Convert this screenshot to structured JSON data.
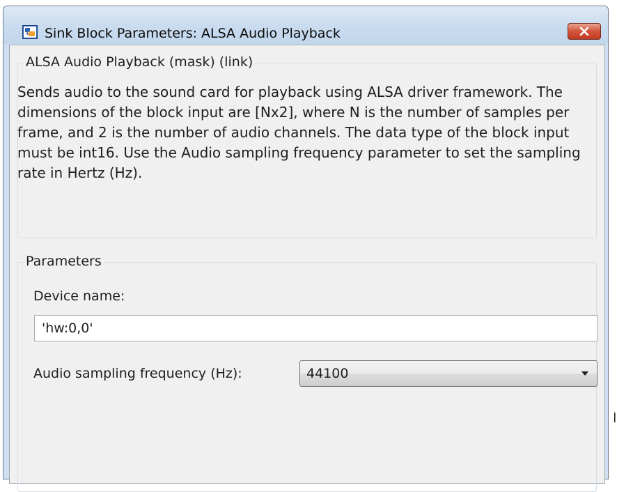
{
  "window": {
    "title": "Sink Block Parameters: ALSA Audio Playback"
  },
  "description_group": {
    "legend": "ALSA Audio Playback (mask) (link)",
    "text": "Sends audio to the sound card for playback using ALSA driver framework. The dimensions of the block input are [Nx2], where N is the number of samples per frame, and 2 is the number of audio channels. The data type of the block input must be int16. Use the Audio sampling frequency parameter to set the sampling rate in Hertz (Hz)."
  },
  "parameters_group": {
    "legend": "Parameters",
    "device_name": {
      "label": "Device name:",
      "value": "'hw:0,0'"
    },
    "sampling_frequency": {
      "label": "Audio sampling frequency (Hz):",
      "selected": "44100"
    }
  },
  "icons": {
    "app": "simulink-block-icon",
    "close": "close-icon",
    "dropdown": "chevron-down-icon"
  },
  "colors": {
    "close_button": "#c94a31",
    "title_bar": "#c9dbef",
    "client_background": "#f0f0f0"
  }
}
